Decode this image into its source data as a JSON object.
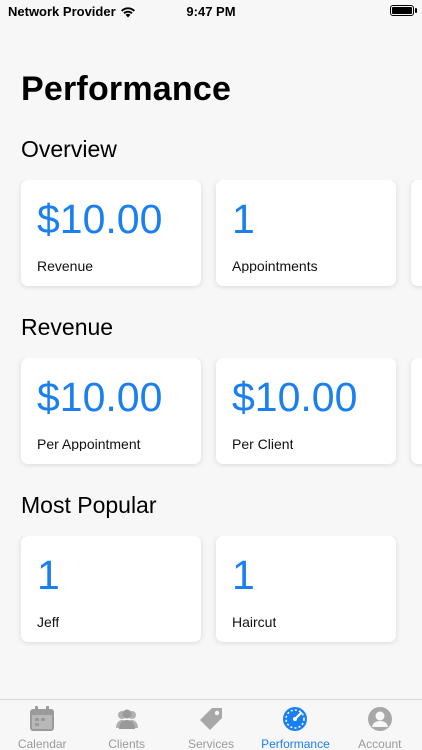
{
  "status": {
    "carrier": "Network Provider",
    "time": "9:47 PM"
  },
  "page_title": "Performance",
  "sections": {
    "overview": {
      "title": "Overview",
      "cards": [
        {
          "value": "$10.00",
          "label": "Revenue"
        },
        {
          "value": "1",
          "label": "Appointments"
        }
      ]
    },
    "revenue": {
      "title": "Revenue",
      "cards": [
        {
          "value": "$10.00",
          "label": "Per Appointment"
        },
        {
          "value": "$10.00",
          "label": "Per Client"
        }
      ]
    },
    "popular": {
      "title": "Most Popular",
      "cards": [
        {
          "value": "1",
          "label": "Jeff"
        },
        {
          "value": "1",
          "label": "Haircut"
        }
      ]
    }
  },
  "tabs": [
    {
      "label": "Calendar",
      "icon": "calendar-icon"
    },
    {
      "label": "Clients",
      "icon": "clients-icon"
    },
    {
      "label": "Services",
      "icon": "tag-icon"
    },
    {
      "label": "Performance",
      "icon": "speedometer-icon",
      "active": true
    },
    {
      "label": "Account",
      "icon": "account-icon"
    }
  ],
  "colors": {
    "accent": "#1a7ff0",
    "inactive": "#9a9a9a",
    "background": "#f7f7f7"
  }
}
